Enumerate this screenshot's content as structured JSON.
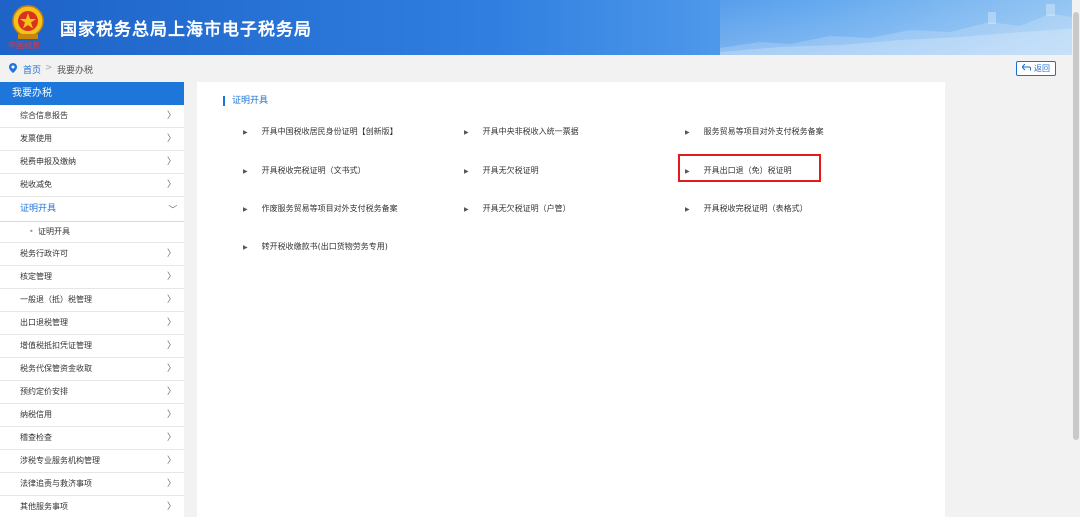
{
  "header": {
    "site_title": "国家税务总局上海市电子税务局",
    "emblem_caption": "中国税务"
  },
  "breadcrumb": {
    "home": "首页",
    "separator": ">",
    "current": "我要办税",
    "back_label": "返回"
  },
  "sidebar": {
    "heading": "我要办税",
    "items": [
      {
        "label": "综合信息报告",
        "chev": "〉"
      },
      {
        "label": "发票使用",
        "chev": "〉"
      },
      {
        "label": "税费申报及缴纳",
        "chev": "〉"
      },
      {
        "label": "税收减免",
        "chev": "〉"
      },
      {
        "label": "证明开具",
        "chev": "〉"
      },
      {
        "label": "证明开具"
      },
      {
        "label": "税务行政许可",
        "chev": "〉"
      },
      {
        "label": "核定管理",
        "chev": "〉"
      },
      {
        "label": "一般退（抵）税管理",
        "chev": "〉"
      },
      {
        "label": "出口退税管理",
        "chev": "〉"
      },
      {
        "label": "增值税抵扣凭证管理",
        "chev": "〉"
      },
      {
        "label": "税务代保管资金收取",
        "chev": "〉"
      },
      {
        "label": "预约定价安排",
        "chev": "〉"
      },
      {
        "label": "纳税信用",
        "chev": "〉"
      },
      {
        "label": "稽查检查",
        "chev": "〉"
      },
      {
        "label": "涉税专业服务机构管理",
        "chev": "〉"
      },
      {
        "label": "法律追责与救济事项",
        "chev": "〉"
      },
      {
        "label": "其他服务事项",
        "chev": "〉"
      }
    ]
  },
  "main": {
    "section_title": "证明开具",
    "bullet": "▶",
    "links": [
      "开具中国税收居民身份证明【创新版】",
      "开具中央非税收入统一票据",
      "服务贸易等项目对外支付税务备案",
      "开具税收完税证明（文书式）",
      "开具无欠税证明",
      "开具出口退（免）税证明",
      "作废服务贸易等项目对外支付税务备案",
      "开具无欠税证明（户管）",
      "开具税收完税证明（表格式）",
      "转开税收缴款书(出口货物劳务专用)"
    ]
  },
  "colors": {
    "primary": "#1d76d9",
    "highlight": "#e11b1b"
  }
}
